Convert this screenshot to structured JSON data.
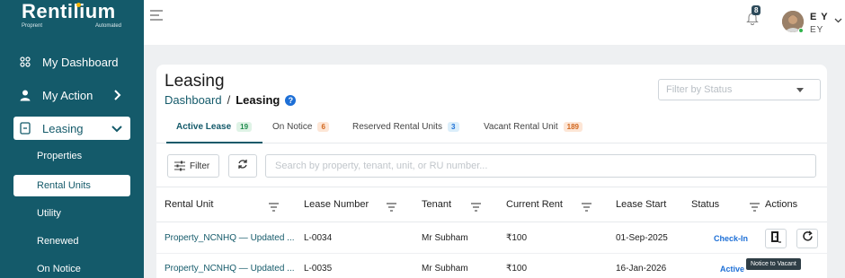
{
  "brand": {
    "name": "Rentilium",
    "tag_left": "Proprent",
    "tag_right": "Automated",
    "colors": {
      "primary": "#145a6a",
      "accent": "#f4b400",
      "link": "#1d6fd6"
    }
  },
  "sidebar": {
    "items": [
      {
        "label": "My Dashboard",
        "icon": "grid-icon"
      },
      {
        "label": "My Action",
        "icon": "user-icon"
      },
      {
        "label": "Leasing",
        "icon": "key-icon",
        "active": true
      }
    ],
    "subitems": [
      {
        "label": "Properties"
      },
      {
        "label": "Rental Units",
        "active": true
      },
      {
        "label": "Utility"
      },
      {
        "label": "Renewed"
      },
      {
        "label": "On Notice"
      }
    ]
  },
  "topbar": {
    "notifications_count": "8",
    "user_initials": "E Y",
    "user_sub": "EY"
  },
  "page": {
    "title": "Leasing",
    "breadcrumb": {
      "root": "Dashboard",
      "separator": "/",
      "current": "Leasing",
      "help": "?"
    },
    "status_filter_placeholder": "Filter by Status"
  },
  "tabs": [
    {
      "label": "Active Lease",
      "count": "19",
      "badge_bg": "#dff3e6",
      "badge_fg": "#1e8a4c",
      "active": true
    },
    {
      "label": "On Notice",
      "count": "6",
      "badge_bg": "#fde6d6",
      "badge_fg": "#d1661d"
    },
    {
      "label": "Reserved Rental Units",
      "count": "3",
      "badge_bg": "#dbeefa",
      "badge_fg": "#1d6fd6"
    },
    {
      "label": "Vacant Rental Unit",
      "count": "189",
      "badge_bg": "#fde6d6",
      "badge_fg": "#d1661d"
    }
  ],
  "toolbar": {
    "filter_label": "Filter",
    "search_placeholder": "Search by property, tenant, unit, or RU number..."
  },
  "table": {
    "columns": [
      "Rental Unit",
      "Lease Number",
      "Tenant",
      "Current Rent",
      "Lease Start",
      "Status",
      "Actions"
    ],
    "rows": [
      {
        "rental_unit": "Property_NCNHQ — Updated ...",
        "lease_number": "L-0034",
        "tenant": "Mr Subham",
        "current_rent": "₹100",
        "lease_start": "01-Sep-2025",
        "status": "Check-In"
      },
      {
        "rental_unit": "Property_NCNHQ — Updated ...",
        "lease_number": "L-0035",
        "tenant": "Mr Subham",
        "current_rent": "₹100",
        "lease_start": "16-Jan-2026",
        "status": "Active"
      }
    ]
  },
  "tooltip": "Notice to Vacant"
}
